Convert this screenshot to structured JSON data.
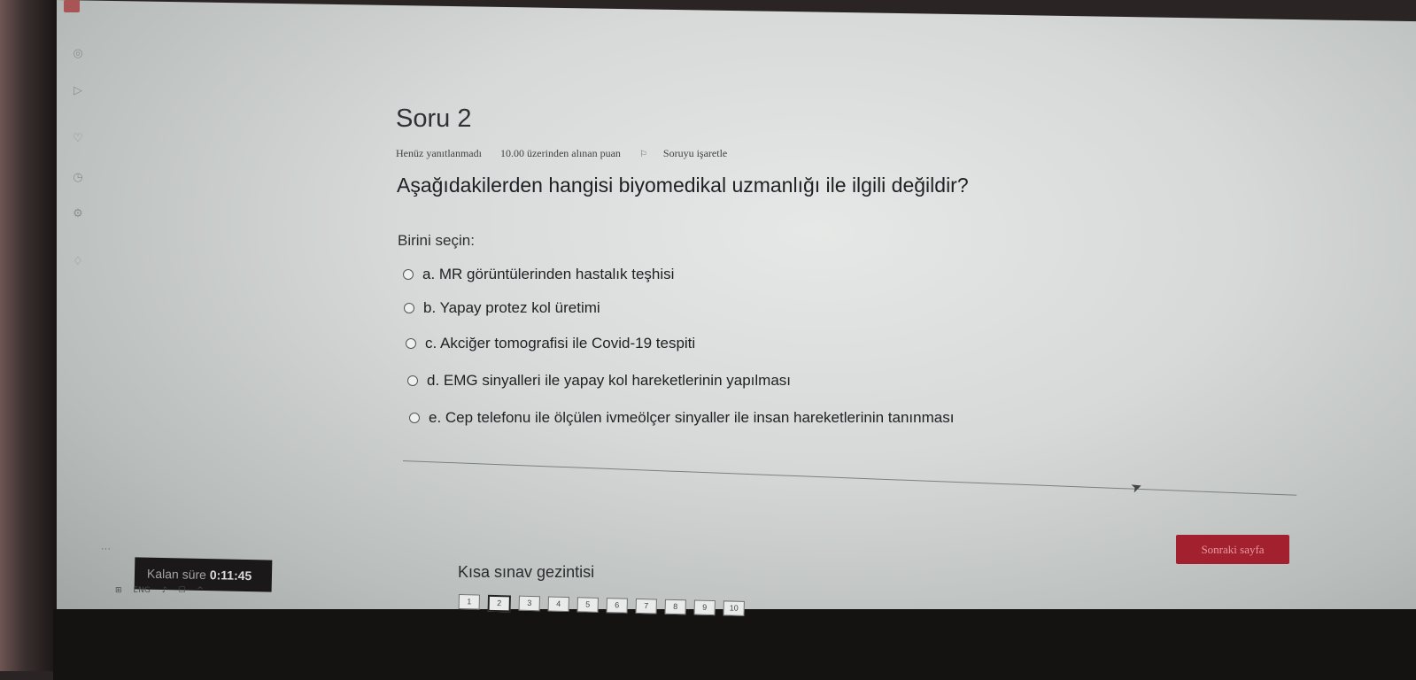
{
  "question": {
    "title": "Soru 2",
    "status": "Henüz yanıtlanmadı",
    "points": "10.00 üzerinden alınan puan",
    "flag_label": "Soruyu işaretle",
    "text": "Aşağıdakilerden hangisi biyomedikal uzmanlığı ile ilgili değildir?",
    "prompt": "Birini seçin:",
    "options": [
      {
        "label": "a. MR görüntülerinden hastalık teşhisi"
      },
      {
        "label": "b. Yapay protez kol üretimi"
      },
      {
        "label": "c. Akciğer tomografisi ile Covid-19 tespiti"
      },
      {
        "label": "d. EMG sinyalleri ile yapay kol hareketlerinin yapılması"
      },
      {
        "label": "e. Cep telefonu ile ölçülen ivmeölçer sinyaller ile insan hareketlerinin tanınması"
      }
    ]
  },
  "next_button": {
    "label": "Sonraki sayfa"
  },
  "timer": {
    "label": "Kalan süre",
    "value": "0:11:45"
  },
  "quiz_nav": {
    "title": "Kısa sınav gezintisi",
    "pages": [
      "1",
      "2",
      "3",
      "4",
      "5",
      "6",
      "7",
      "8",
      "9",
      "10"
    ],
    "current": "2"
  },
  "taskbar": {
    "lang": "ENG"
  }
}
